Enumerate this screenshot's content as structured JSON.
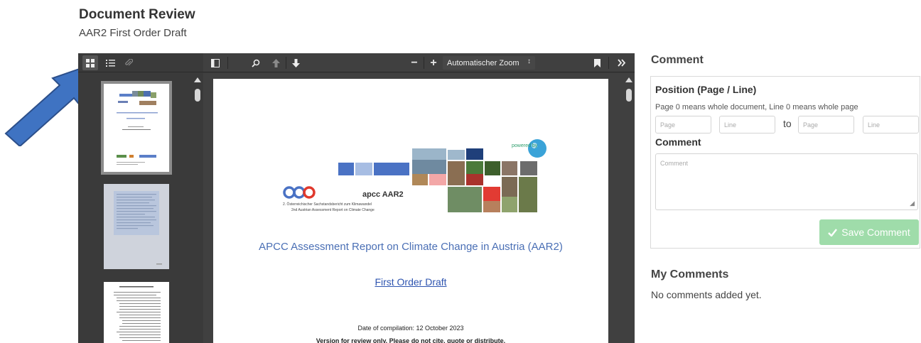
{
  "page": {
    "title": "Document Review",
    "subtitle": "AAR2 First Order Draft"
  },
  "viewer": {
    "toolbar": {
      "zoom_label": "Automatischer Zoom",
      "zoom_caret": "↕"
    },
    "document": {
      "powered_by": "powered by",
      "logo_name": "apcc AAR2",
      "logo_line1": "2. Österreichischer Sachstandsbericht zum Klimawandel",
      "logo_line2": "2nd Austrian Assessment Report on Climate Change",
      "title": "APCC Assessment Report on Climate Change in Austria (AAR2)",
      "subtitle": "First Order Draft",
      "date": "Date of compilation: 12 October 2023",
      "note": "Version for review only. Please do not cite, quote or distribute."
    }
  },
  "comment_form": {
    "heading": "Comment",
    "position_label": "Position (Page / Line)",
    "hint": "Page 0 means whole document, Line 0 means whole page",
    "page_placeholder": "Page",
    "line_placeholder": "Line",
    "to_label": "to",
    "page2_placeholder": "Page",
    "line2_placeholder": "Line",
    "comment_label": "Comment",
    "comment_placeholder": "Comment",
    "save_label": "Save Comment"
  },
  "my_comments": {
    "heading": "My Comments",
    "empty_text": "No comments added yet."
  },
  "colors": {
    "save_button": "#9fdcaa",
    "viewer_toolbar": "#404040",
    "annotation_arrow": "#3f73c2",
    "doc_title": "#4a6fb5"
  }
}
